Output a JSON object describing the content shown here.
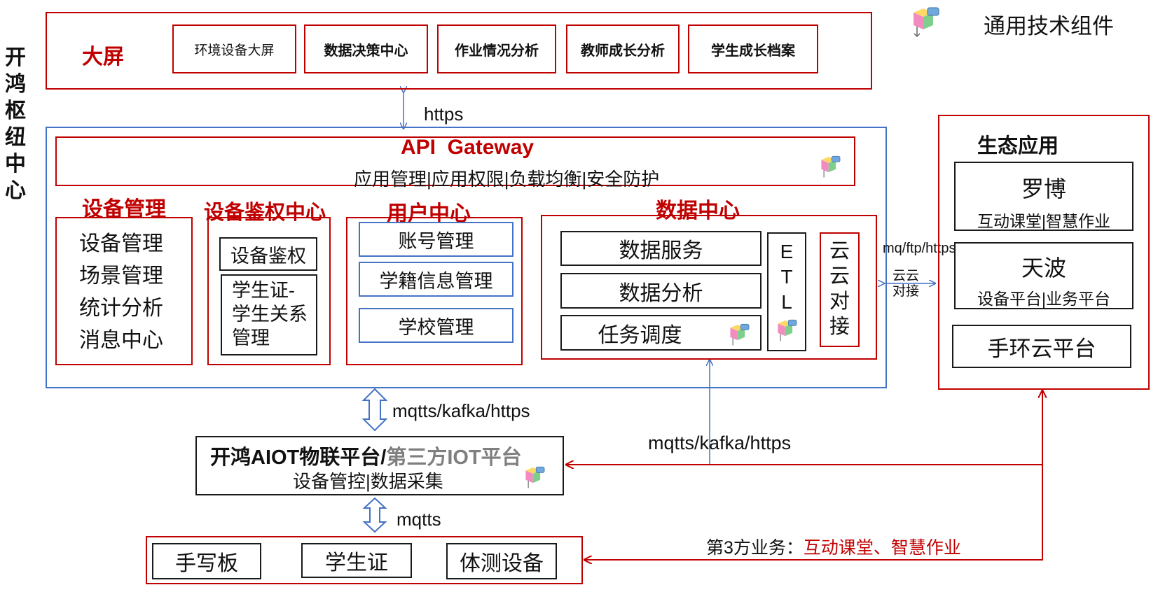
{
  "vertical_title": [
    "开",
    "鸿",
    "枢",
    "纽",
    "中",
    "心"
  ],
  "legend": {
    "label": "通用技术组件",
    "icon": "generic-component-icon"
  },
  "screen": {
    "title": "大屏",
    "items": [
      "环境设备大屏",
      "数据决策中心",
      "作业情况分析",
      "教师成长分析",
      "学生成长档案"
    ]
  },
  "links": {
    "screen_gateway": "https",
    "hub_aiot": "mqtts/kafka/https",
    "aiot_data": "mqtts/kafka/https",
    "aiot_devices": "mqtts",
    "cloud_protocol": "mq/ftp/https",
    "cloud_label": [
      "云云",
      "对接"
    ]
  },
  "gateway": {
    "title": "API  Gateway",
    "subtitle": "应用管理|应用权限|负载均衡|安全防护"
  },
  "device_mgmt": {
    "title": "设备管理",
    "items": [
      "设备管理",
      "场景管理",
      "统计分析",
      "消息中心"
    ]
  },
  "device_auth": {
    "title": "设备鉴权中心",
    "items": [
      "设备鉴权",
      "学生证-学生关系管理"
    ]
  },
  "user_center": {
    "title": "用户中心",
    "items": [
      "账号管理",
      "学籍信息管理",
      "学校管理"
    ]
  },
  "data_center": {
    "title": "数据中心",
    "items": [
      "数据服务",
      "数据分析",
      "任务调度"
    ],
    "etl": [
      "E",
      "T",
      "L"
    ],
    "cloud": [
      "云",
      "云",
      "对",
      "接"
    ]
  },
  "eco": {
    "title": "生态应用",
    "items": [
      {
        "name": "罗博",
        "sub": "互动课堂|智慧作业"
      },
      {
        "name": "天波",
        "sub": "设备平台|业务平台"
      },
      {
        "name": "手环云平台",
        "sub": ""
      }
    ]
  },
  "aiot": {
    "title_main": "开鸿AIOT物联平台/",
    "title_third": "第三方IOT平台",
    "subtitle": "设备管控|数据采集"
  },
  "devices": [
    "手写板",
    "学生证",
    "体测设备"
  ],
  "third_party": {
    "label": "第3方业务：",
    "value": "互动课堂、智慧作业"
  },
  "colors": {
    "red": "#c00000",
    "blue": "#4472c4",
    "black": "#1a1a1a"
  }
}
